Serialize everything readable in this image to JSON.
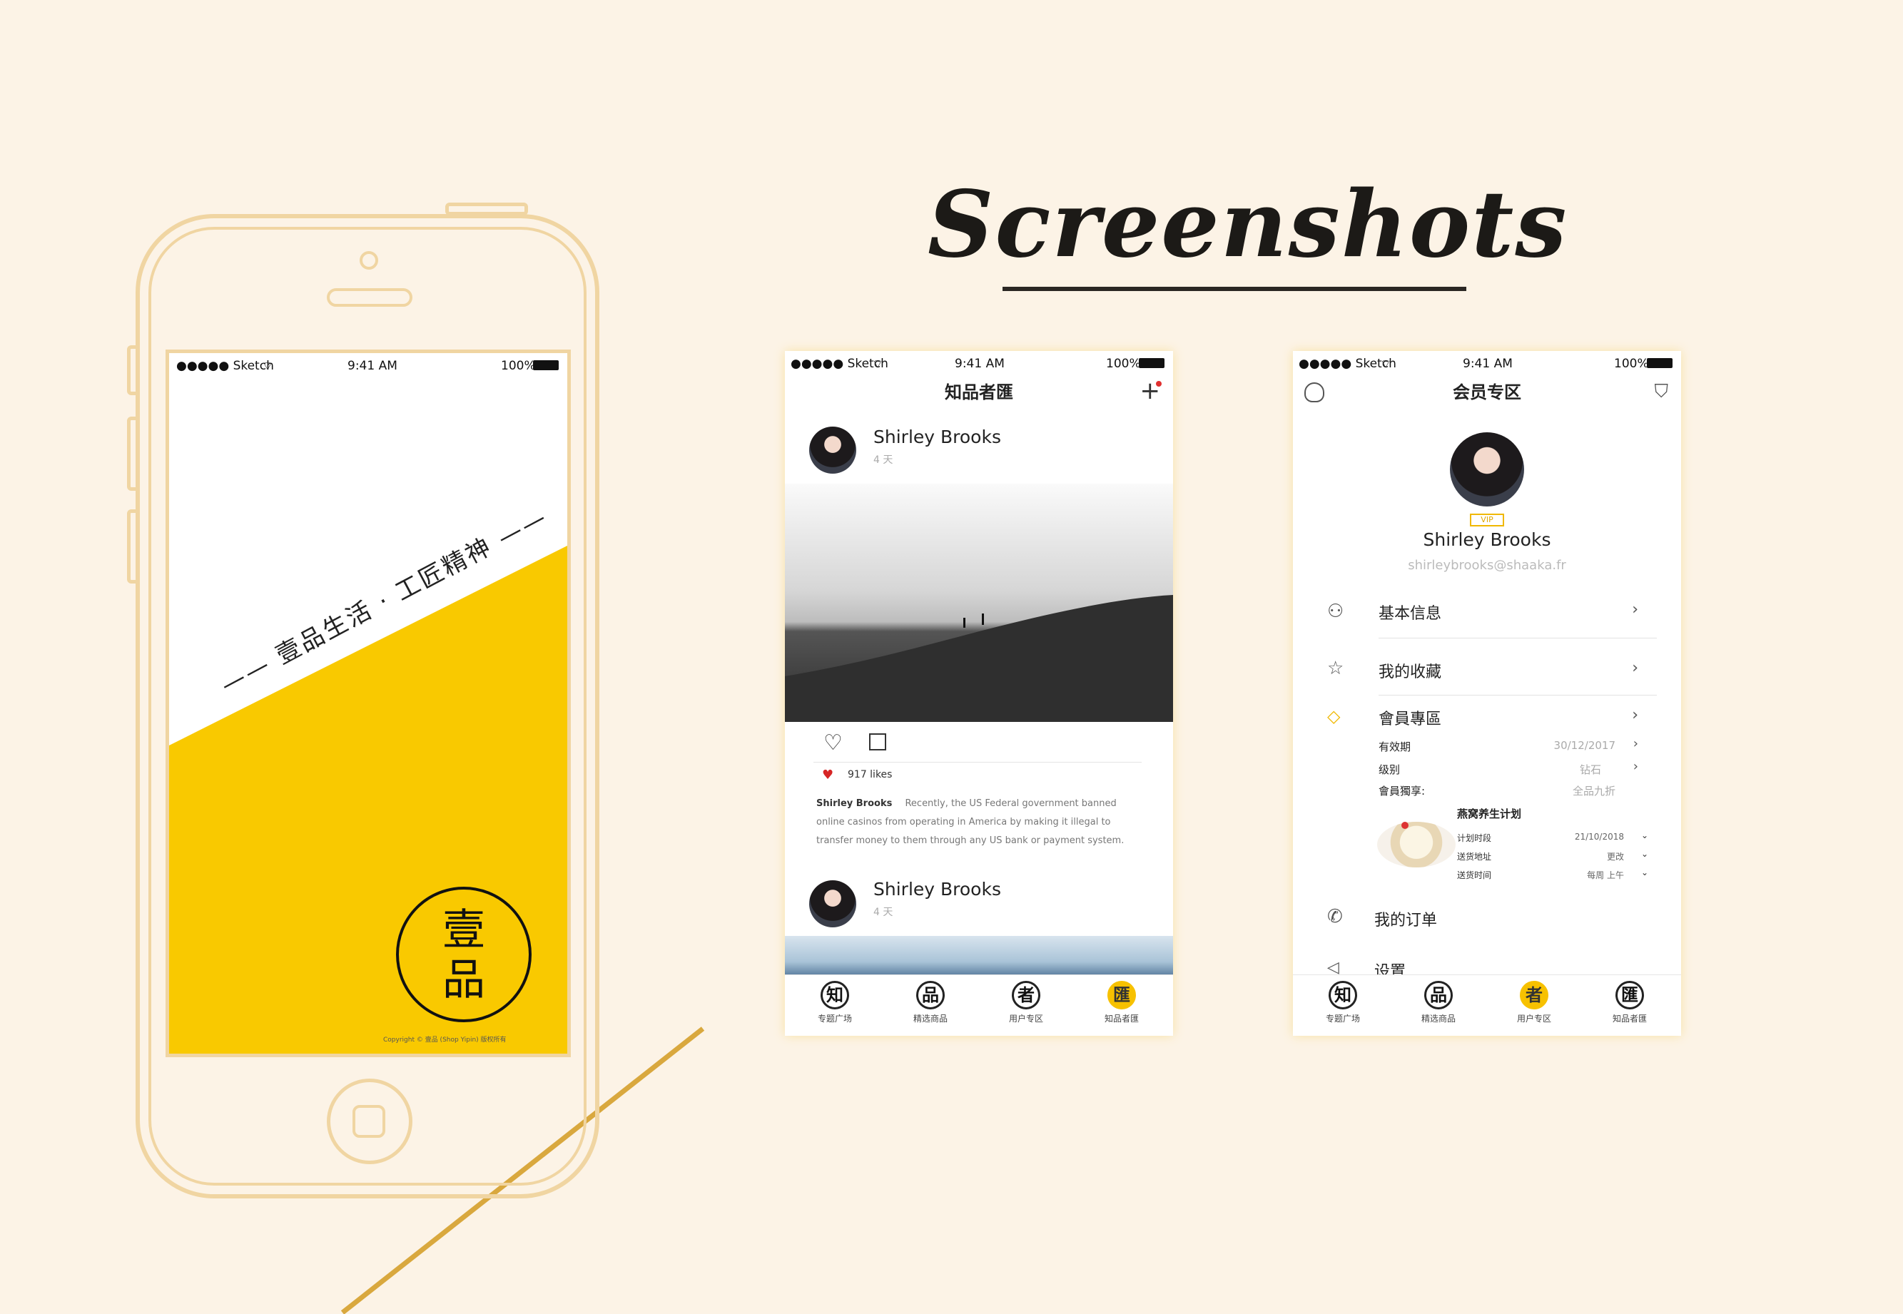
{
  "page": {
    "title": "Screenshots"
  },
  "status_bar": {
    "carrier": "●●●●● Sketch",
    "wifi": "wifi-icon",
    "time": "9:41 AM",
    "battery": "100%"
  },
  "splash": {
    "slogan": "——  壹品生活 · 工匠精神  ——",
    "brand_top": "壹",
    "brand_bottom": "品",
    "copyright": "Copyright ©   壹品 (Shop Yipin) 版权所有",
    "accent": "#f9c900"
  },
  "feed": {
    "nav_title": "知品者匯",
    "add_icon": "plus-icon",
    "posts": [
      {
        "author": "Shirley Brooks",
        "time": "4 天"
      },
      {
        "author": "Shirley Brooks",
        "time": "4 天"
      }
    ],
    "likes": "917 likes",
    "caption_author": "Shirley Brooks",
    "caption_text": "Recently, the US Federal government banned online casinos from operating in America by making it illegal to transfer money to them through any US bank or payment system."
  },
  "member": {
    "nav_title": "会员专区",
    "left_icon": "customer-service-icon",
    "right_icon": "cart-icon",
    "vip": "VIP",
    "name": "Shirley Brooks",
    "email": "shirleybrooks@shaaka.fr",
    "menu": [
      {
        "label": "基本信息",
        "icon": "user-icon"
      },
      {
        "label": "我的收藏",
        "icon": "star-icon"
      },
      {
        "label": "會員專區",
        "icon": "diamond-icon"
      }
    ],
    "details": [
      {
        "label": "有效期",
        "value": "30/12/2017"
      },
      {
        "label": "级别",
        "value": "钻石"
      },
      {
        "label": "會員獨享:",
        "value": "全品九折"
      }
    ],
    "plan": {
      "title": "燕窝养生计划",
      "rows": [
        {
          "label": "计划时段",
          "value": "21/10/2018"
        },
        {
          "label": "送货地址",
          "value": "更改"
        },
        {
          "label": "送货时间",
          "value": "每周    上午"
        }
      ]
    },
    "orders": "我的订单",
    "settings": "设置"
  },
  "tabs_feed": [
    {
      "glyph": "知",
      "label": "专题广场"
    },
    {
      "glyph": "品",
      "label": "精选商品"
    },
    {
      "glyph": "者",
      "label": "用户专区"
    },
    {
      "glyph": "匯",
      "label": "知品者匯"
    }
  ],
  "tabs_member": [
    {
      "glyph": "知",
      "label": "专题广场"
    },
    {
      "glyph": "品",
      "label": "精选商品"
    },
    {
      "glyph": "者",
      "label": "用户专区"
    },
    {
      "glyph": "匯",
      "label": "知品者匯"
    }
  ]
}
